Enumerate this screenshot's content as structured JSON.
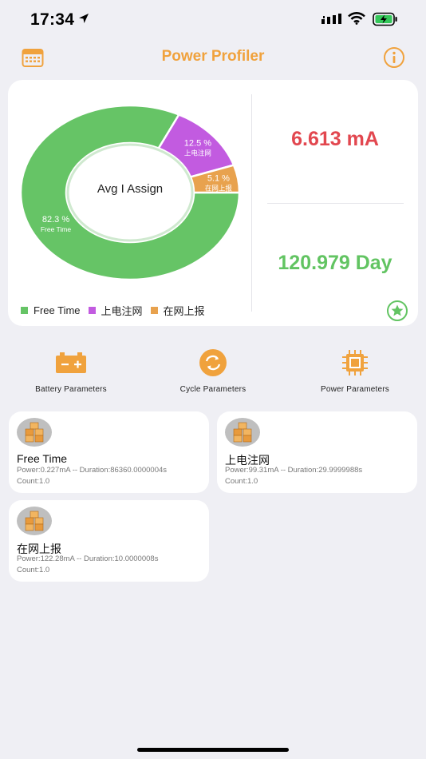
{
  "status": {
    "time": "17:34"
  },
  "nav": {
    "title": "Power Profiler"
  },
  "summary": {
    "current": "6.613 mA",
    "duration": "120.979 Day"
  },
  "chart_data": {
    "type": "pie",
    "center_label": "Avg I Assign",
    "categories": [
      "Free Time",
      "上电注网",
      "在网上报"
    ],
    "values": [
      82.3,
      12.5,
      5.1
    ],
    "value_labels": [
      "82.3 %",
      "12.5 %",
      "5.1 %"
    ],
    "colors": [
      "#66c466",
      "#c25be0",
      "#e8a24e"
    ],
    "legend": [
      "Free Time",
      "上电注网",
      "在网上报"
    ],
    "legend_position": "bottom-left"
  },
  "actions": [
    {
      "label": "Battery Parameters",
      "icon": "battery-icon"
    },
    {
      "label": "Cycle Parameters",
      "icon": "cycle-icon"
    },
    {
      "label": "Power Parameters",
      "icon": "chip-icon"
    }
  ],
  "modes": [
    {
      "name": "Free Time",
      "detail": "Power:0.227mA -- Duration:86360.0000004s",
      "count": "Count:1.0"
    },
    {
      "name": "上电注网",
      "detail": "Power:99.31mA -- Duration:29.9999988s",
      "count": "Count:1.0"
    },
    {
      "name": "在网上报",
      "detail": "Power:122.28mA -- Duration:10.0000008s",
      "count": "Count:1.0"
    }
  ],
  "colors": {
    "accent": "#f0a23d",
    "current": "#e2474f",
    "days": "#62c462",
    "background": "#efeff4"
  }
}
